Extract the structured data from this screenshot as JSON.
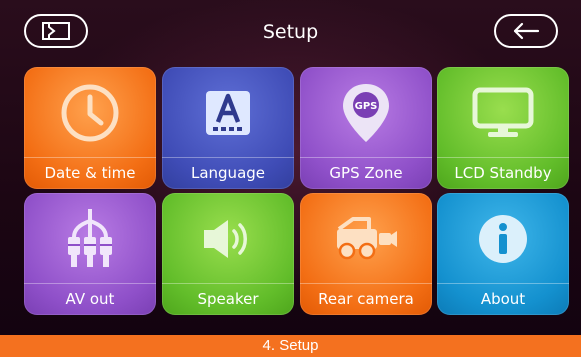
{
  "header": {
    "title": "Setup"
  },
  "tiles": [
    {
      "label": "Date & time",
      "icon": "clock-icon",
      "color": "#f36e14"
    },
    {
      "label": "Language",
      "icon": "language-icon",
      "color": "#3f4cb6"
    },
    {
      "label": "GPS Zone",
      "icon": "gps-pin-icon",
      "color": "#8f50c9",
      "icon_text": "GPS"
    },
    {
      "label": "LCD Standby",
      "icon": "monitor-icon",
      "color": "#62bd2a"
    },
    {
      "label": "AV out",
      "icon": "av-cable-icon",
      "color": "#8f50c9"
    },
    {
      "label": "Speaker",
      "icon": "speaker-icon",
      "color": "#62bd2a"
    },
    {
      "label": "Rear camera",
      "icon": "rear-camera-icon",
      "color": "#f36e14"
    },
    {
      "label": "About",
      "icon": "info-icon",
      "color": "#1491cf"
    }
  ],
  "footer": {
    "caption": "4. Setup"
  }
}
